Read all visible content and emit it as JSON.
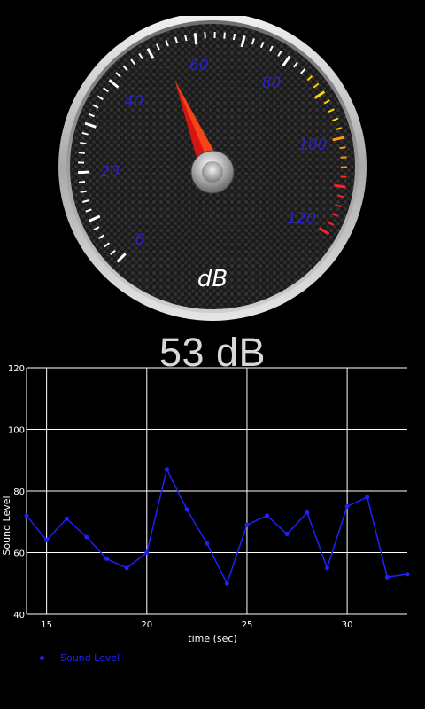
{
  "gauge": {
    "unit_label": "dB",
    "value": 53,
    "scale_min": 0,
    "scale_max": 120,
    "scale_labels": [
      "0",
      "20",
      "40",
      "60",
      "80",
      "100",
      "120"
    ],
    "label_color": "#2a1fd6",
    "needle_color": "#e01010",
    "warning_color": "#ffd400",
    "danger_color": "#ff2020"
  },
  "readout": {
    "text": "53 dB"
  },
  "chart_data": {
    "type": "line",
    "xlabel": "time (sec)",
    "ylabel": "Sound Level",
    "xlim": [
      14,
      33
    ],
    "ylim": [
      40,
      120
    ],
    "x_ticks": [
      "15",
      "20",
      "25",
      "30"
    ],
    "y_ticks": [
      "40",
      "60",
      "80",
      "100",
      "120"
    ],
    "grid": true,
    "legend_position": "bottom-left",
    "series": [
      {
        "name": "Sound Level",
        "color": "#2020ff",
        "x": [
          14,
          15,
          16,
          17,
          18,
          19,
          20,
          21,
          22,
          23,
          24,
          25,
          26,
          27,
          28,
          29,
          30,
          31,
          32,
          33
        ],
        "y": [
          72,
          64,
          71,
          65,
          58,
          55,
          60,
          87,
          74,
          63,
          50,
          69,
          72,
          66,
          73,
          55,
          75,
          78,
          52,
          53
        ]
      }
    ]
  }
}
